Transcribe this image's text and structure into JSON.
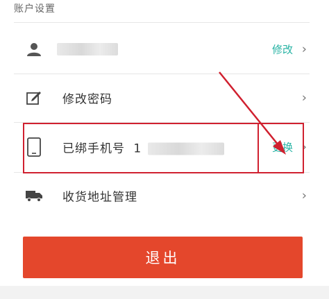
{
  "section": {
    "title": "账户设置"
  },
  "rows": [
    {
      "id": "profile",
      "icon": "user-icon",
      "label": "",
      "action": "修改",
      "chevron": "›"
    },
    {
      "id": "change-password",
      "icon": "edit-icon",
      "label": "修改密码",
      "action": "",
      "chevron": "›"
    },
    {
      "id": "bound-phone",
      "icon": "phone-icon",
      "label": "已绑手机号",
      "phone_prefix": "1",
      "action": "更换",
      "chevron": "›"
    },
    {
      "id": "address-management",
      "icon": "truck-icon",
      "label": "收货地址管理",
      "action": "",
      "chevron": "›"
    }
  ],
  "logout": {
    "label": "退出"
  },
  "colors": {
    "accent": "#27b3a4",
    "logout_bg": "#e4472c",
    "annotation_red": "#d0202f"
  }
}
